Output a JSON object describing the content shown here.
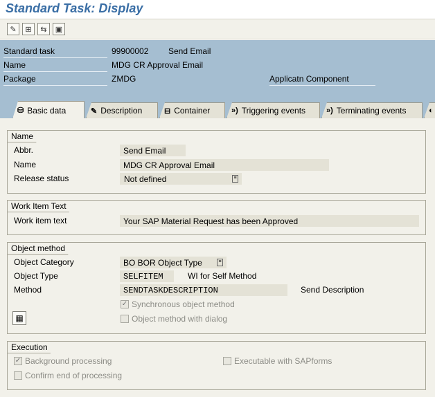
{
  "window": {
    "title": "Standard Task: Display"
  },
  "toolbar": {
    "buttons": [
      {
        "icon": "edit-pencil-icon",
        "glyph": "✎"
      },
      {
        "icon": "hierarchy-icon",
        "glyph": "⊞"
      },
      {
        "icon": "transfer-icon",
        "glyph": "⇆"
      },
      {
        "icon": "document-icon",
        "glyph": "▣"
      }
    ]
  },
  "header": {
    "standard_task_label": "Standard task",
    "standard_task_id": "99900002",
    "standard_task_name": "Send Email",
    "name_label": "Name",
    "name_value": "MDG CR Approval Email",
    "package_label": "Package",
    "package_value": "ZMDG",
    "app_component_label": "Applicatn Component"
  },
  "tabs": [
    {
      "label": "Basic data",
      "icon": "basic-data-icon",
      "glyph": "⛁",
      "active": true
    },
    {
      "label": "Description",
      "icon": "description-icon",
      "glyph": "✎",
      "active": false
    },
    {
      "label": "Container",
      "icon": "container-icon",
      "glyph": "⊟",
      "active": false
    },
    {
      "label": "Triggering events",
      "icon": "triggering-events-icon",
      "glyph": "»)",
      "active": false
    },
    {
      "label": "Terminating events",
      "icon": "terminating-events-icon",
      "glyph": "»)",
      "active": false
    }
  ],
  "name_group": {
    "title": "Name",
    "abbr_label": "Abbr.",
    "abbr_value": "Send Email",
    "name_label": "Name",
    "name_value": "MDG CR Approval Email",
    "release_label": "Release status",
    "release_value": "Not defined"
  },
  "work_item_group": {
    "title": "Work Item Text",
    "text_label": "Work item text",
    "text_value": "Your SAP Material Request has been Approved"
  },
  "object_method_group": {
    "title": "Object method",
    "category_label": "Object Category",
    "category_value": "BO BOR Object Type",
    "type_label": "Object Type",
    "type_value": "SELFITEM",
    "type_desc": "WI for Self Method",
    "method_label": "Method",
    "method_value": "SENDTASKDESCRIPTION",
    "method_desc": "Send Description",
    "sync_label": "Synchronous object method",
    "sync_checked": true,
    "dialog_label": "Object method with dialog",
    "dialog_checked": false
  },
  "execution_group": {
    "title": "Execution",
    "background_label": "Background processing",
    "background_checked": true,
    "sapforms_label": "Executable with SAPforms",
    "sapforms_checked": false,
    "confirm_label": "Confirm end of processing",
    "confirm_checked": false
  }
}
